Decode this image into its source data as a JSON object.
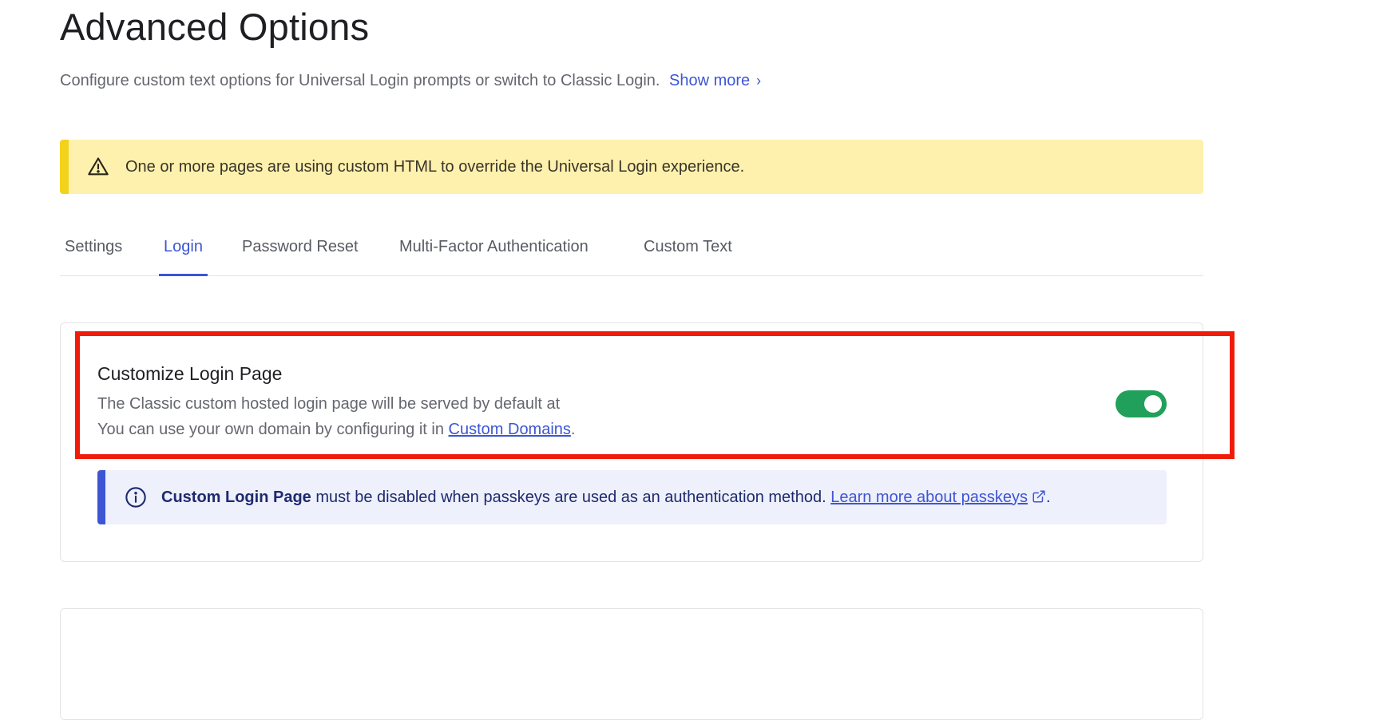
{
  "header": {
    "title": "Advanced Options",
    "description": "Configure custom text options for Universal Login prompts or switch to Classic Login.",
    "show_more": "Show more"
  },
  "warning": {
    "icon": "warning-triangle-icon",
    "text": "One or more pages are using custom HTML to override the Universal Login experience."
  },
  "tabs": [
    {
      "label": "Settings",
      "active": false
    },
    {
      "label": "Login",
      "active": true
    },
    {
      "label": "Password Reset",
      "active": false
    },
    {
      "label": "Multi-Factor Authentication",
      "active": false
    },
    {
      "label": "Custom Text",
      "active": false
    }
  ],
  "setting": {
    "title": "Customize Login Page",
    "line1": "The Classic custom hosted login page will be served by default at",
    "line2_prefix": "You can use your own domain by configuring it in ",
    "line2_link": "Custom Domains",
    "line2_suffix": ".",
    "toggle_on": true
  },
  "info": {
    "icon": "info-circle-icon",
    "bold": "Custom Login Page",
    "text": " must be disabled when passkeys are used as an authentication method. ",
    "link": "Learn more about passkeys",
    "suffix": "."
  },
  "colors": {
    "accent": "#3e55d3",
    "toggle_on": "#20a05a",
    "warning_bg": "#fdf1ad",
    "warning_border": "#f2d21b",
    "highlight": "#f01c0a"
  }
}
